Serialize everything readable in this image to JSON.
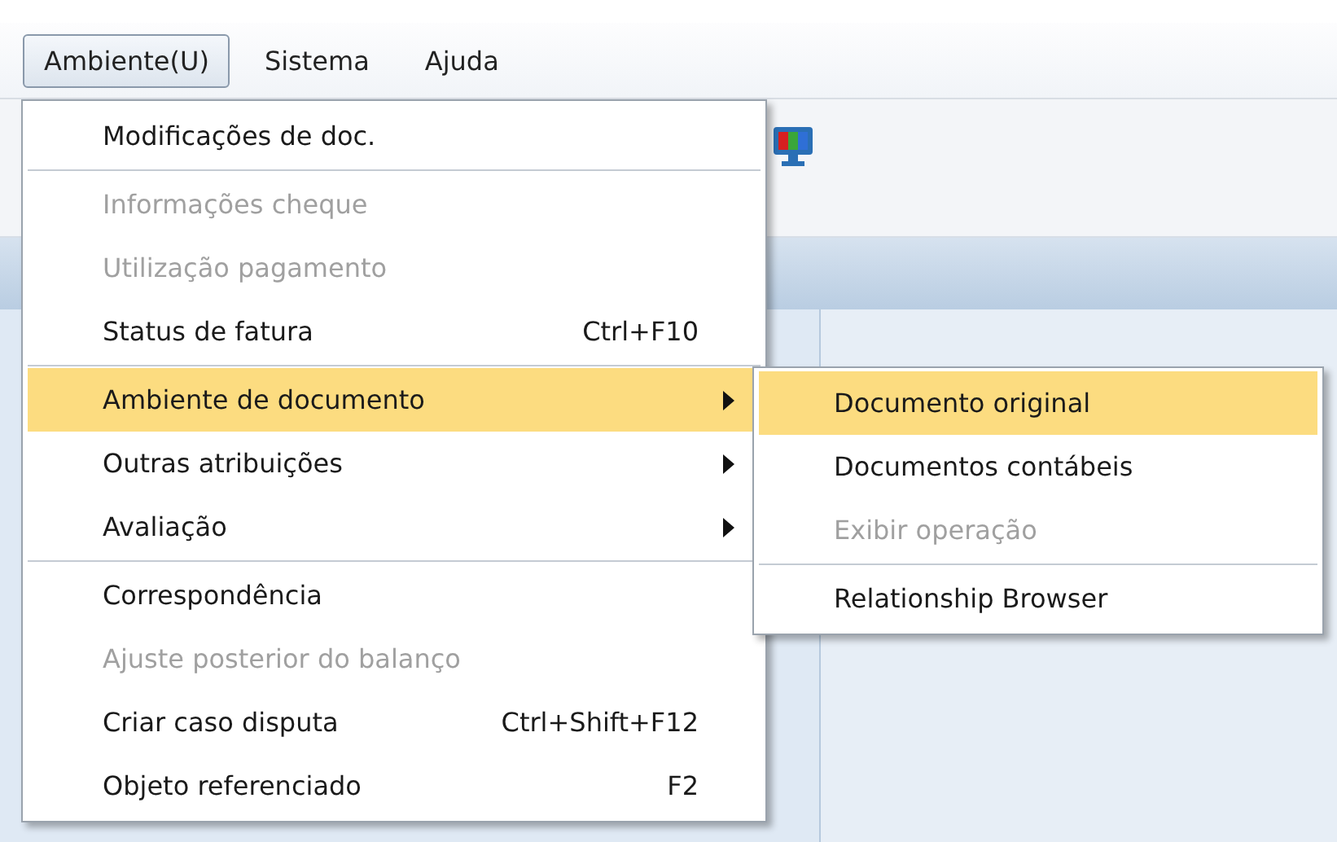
{
  "menubar": [
    {
      "label": "Ambiente(U)",
      "selected": true
    },
    {
      "label": "Sistema",
      "selected": false
    },
    {
      "label": "Ajuda",
      "selected": false
    }
  ],
  "menu": [
    {
      "kind": "item",
      "label": "Modificações de doc.",
      "disabled": false,
      "selected": false
    },
    {
      "kind": "separator"
    },
    {
      "kind": "item",
      "label": "Informações cheque",
      "disabled": true,
      "selected": false
    },
    {
      "kind": "item",
      "label": "Utilização pagamento",
      "disabled": true,
      "selected": false
    },
    {
      "kind": "item",
      "label": "Status de fatura",
      "shortcut": "Ctrl+F10",
      "disabled": false,
      "selected": false
    },
    {
      "kind": "separator"
    },
    {
      "kind": "item",
      "label": "Ambiente de documento",
      "submenu": true,
      "disabled": false,
      "selected": true
    },
    {
      "kind": "item",
      "label": "Outras atribuições",
      "submenu": true,
      "disabled": false,
      "selected": false
    },
    {
      "kind": "item",
      "label": "Avaliação",
      "submenu": true,
      "disabled": false,
      "selected": false
    },
    {
      "kind": "separator"
    },
    {
      "kind": "item",
      "label": "Correspondência",
      "disabled": false,
      "selected": false
    },
    {
      "kind": "item",
      "label": "Ajuste posterior do balanço",
      "disabled": true,
      "selected": false
    },
    {
      "kind": "item",
      "label": "Criar caso disputa",
      "shortcut": "Ctrl+Shift+F12",
      "disabled": false,
      "selected": false
    },
    {
      "kind": "item",
      "label": "Objeto referenciado",
      "shortcut": "F2",
      "disabled": false,
      "selected": false
    }
  ],
  "submenu": [
    {
      "kind": "item",
      "label": "Documento original",
      "disabled": false,
      "selected": true
    },
    {
      "kind": "item",
      "label": "Documentos contábeis",
      "disabled": false,
      "selected": false
    },
    {
      "kind": "item",
      "label": "Exibir operação",
      "disabled": true,
      "selected": false
    },
    {
      "kind": "separator"
    },
    {
      "kind": "item",
      "label": "Relationship Browser",
      "disabled": false,
      "selected": false
    }
  ]
}
